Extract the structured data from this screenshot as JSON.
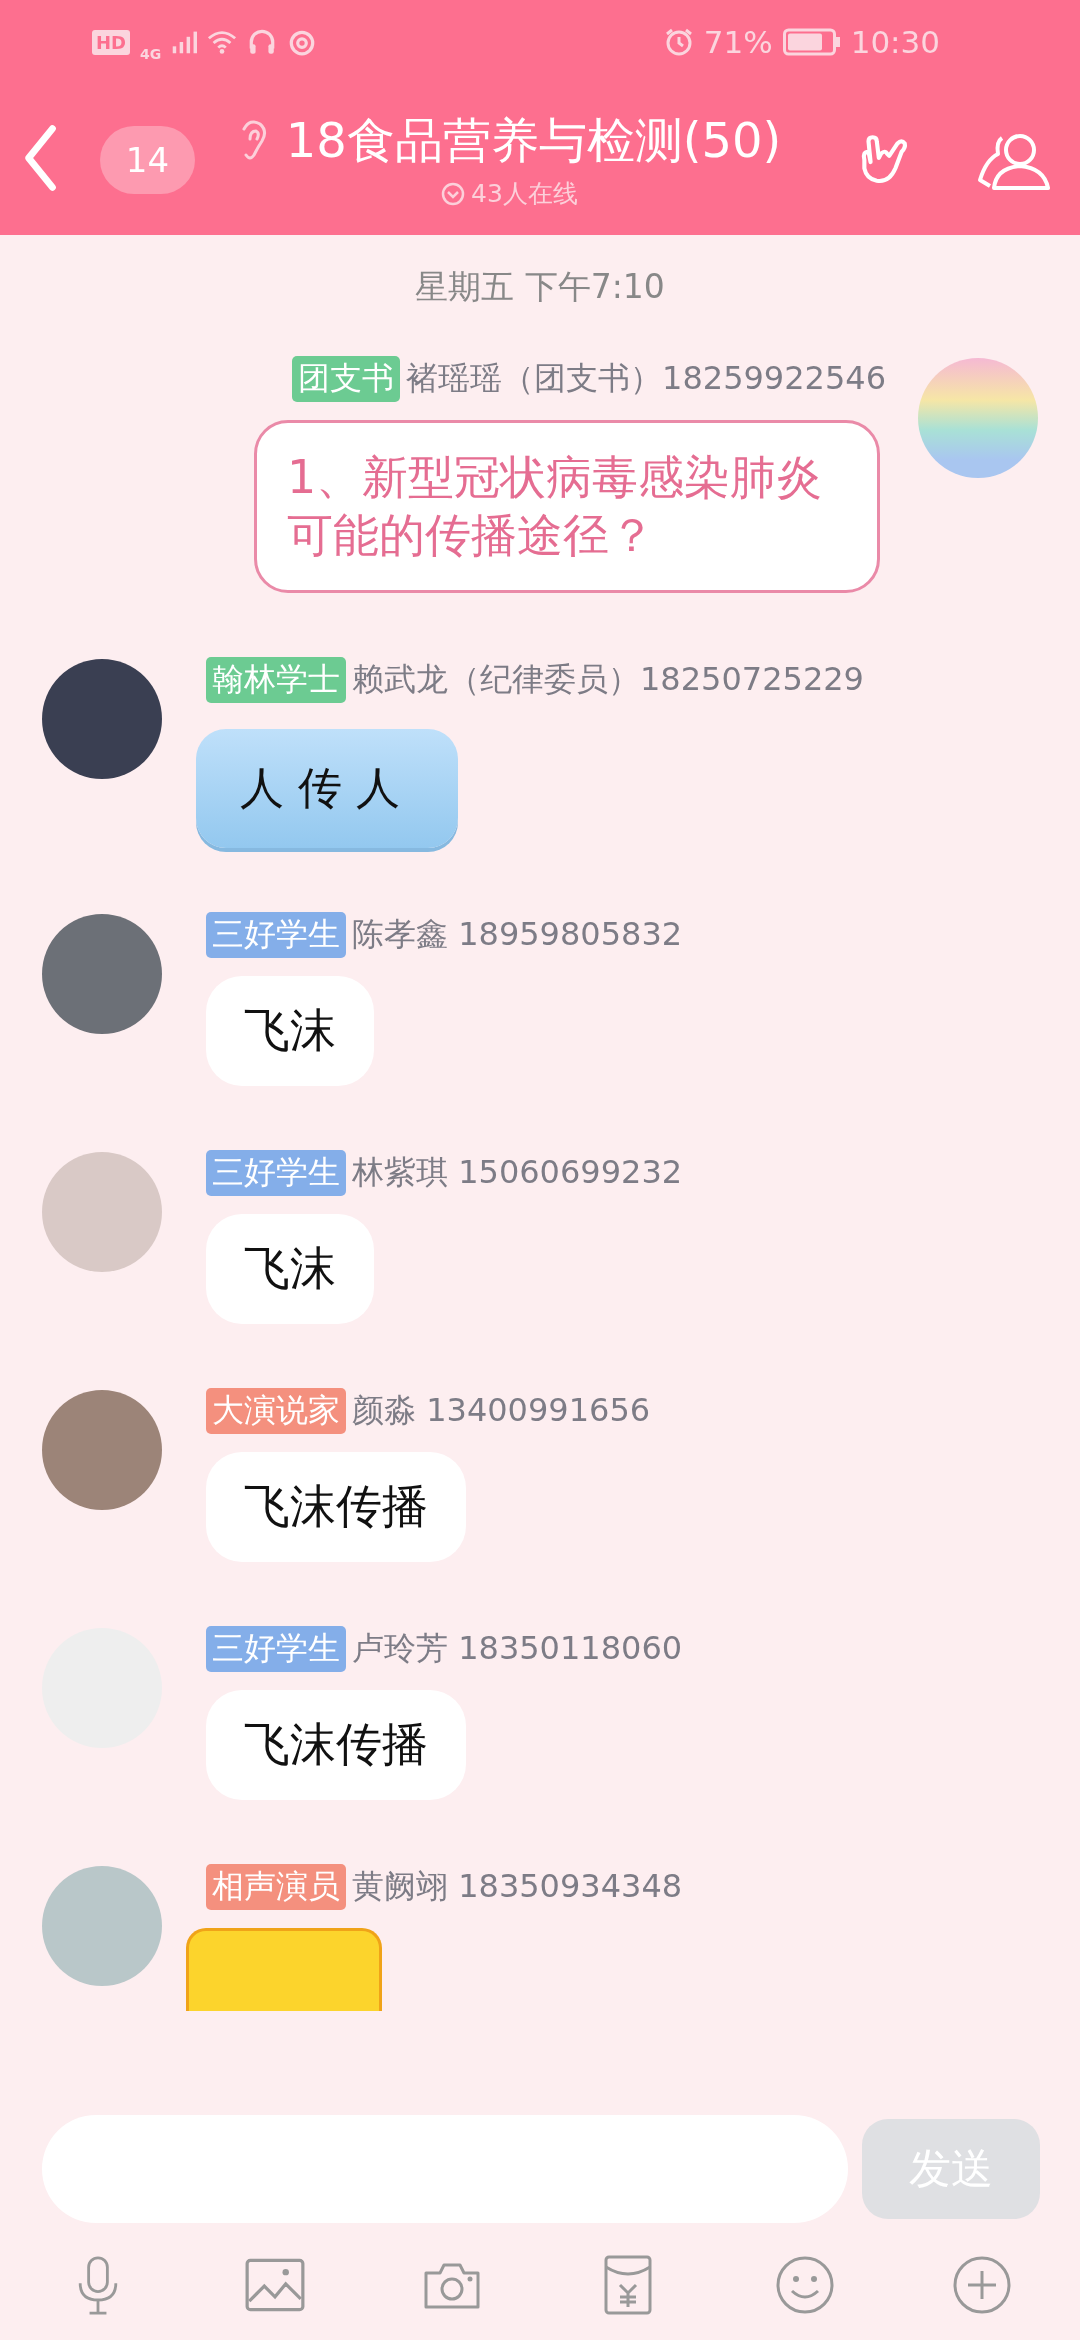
{
  "status_bar": {
    "hd": "HD",
    "network": "4G",
    "battery_percent": "71%",
    "time": "10:30"
  },
  "header": {
    "unread_count": "14",
    "title": "18食品营养与检测(50)",
    "online": "43人在线"
  },
  "date_divider": "星期五 下午7:10",
  "messages": [
    {
      "outgoing": true,
      "badge": "团支书",
      "color": "#6ccb92",
      "sender": "褚瑶瑶（团支书）18259922546",
      "kind": "outlined",
      "text": "1、新型冠状病毒感染肺炎可能的传播途径？"
    },
    {
      "outgoing": false,
      "badge": "翰林学士",
      "color": "#6ccb92",
      "sender": "赖武龙（纪律委员）18250725229",
      "kind": "hippo",
      "text": "人传人"
    },
    {
      "outgoing": false,
      "badge": "三好学生",
      "color": "#84aee9",
      "sender": "陈孝鑫  18959805832",
      "kind": "plain",
      "text": "飞沫"
    },
    {
      "outgoing": false,
      "badge": "三好学生",
      "color": "#84aee9",
      "sender": "林紫琪 15060699232",
      "kind": "plain",
      "text": "飞沫"
    },
    {
      "outgoing": false,
      "badge": "大演说家",
      "color": "#f4907e",
      "sender": "颜淼 13400991656",
      "kind": "plain",
      "text": "飞沫传播"
    },
    {
      "outgoing": false,
      "badge": "三好学生",
      "color": "#84aee9",
      "sender": "卢玲芳 18350118060",
      "kind": "plain",
      "text": "飞沫传播"
    },
    {
      "outgoing": false,
      "badge": "相声演员",
      "color": "#f4907e",
      "sender": "黄阙翊  18350934348",
      "kind": "sticker"
    }
  ],
  "composer": {
    "send_button": "发送"
  }
}
